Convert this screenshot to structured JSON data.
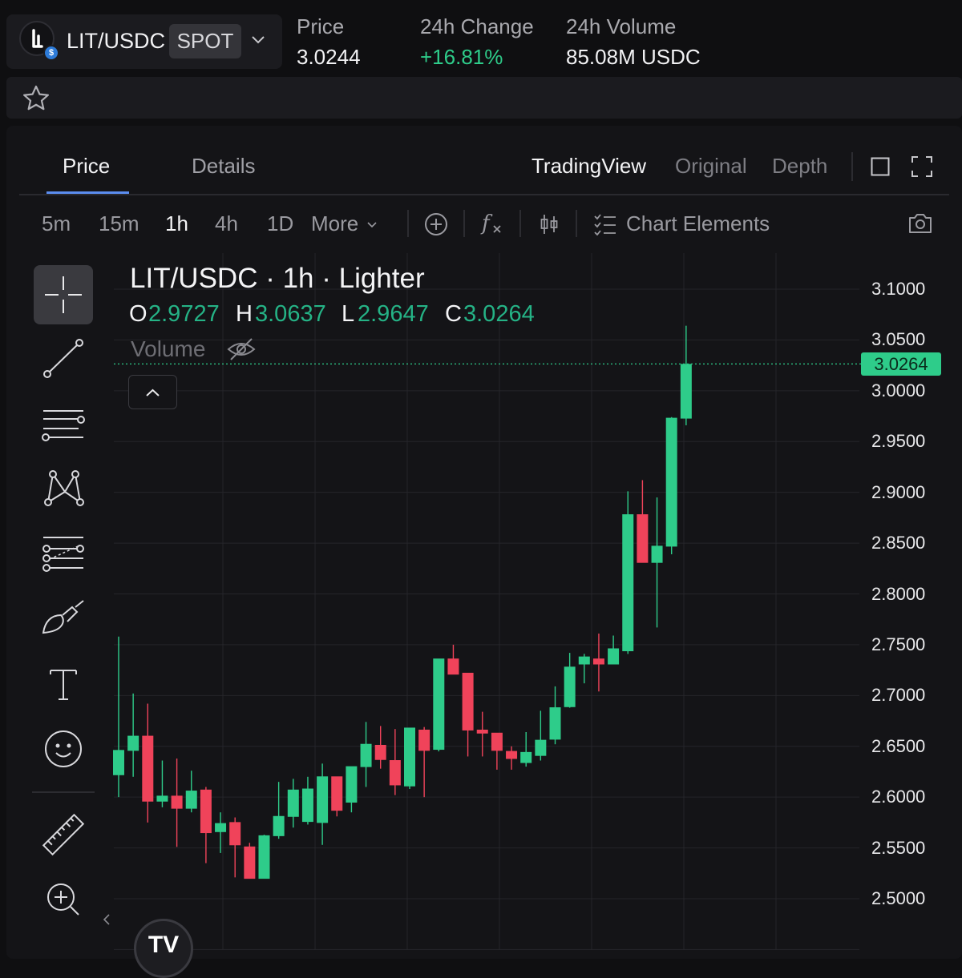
{
  "market": {
    "pair": "LIT/USDC",
    "type_badge": "SPOT",
    "stats": [
      {
        "label": "Price",
        "value": "3.0244",
        "color": "#f2f2f4"
      },
      {
        "label": "24h Change",
        "value": "+16.81%",
        "color": "#2ecc8a"
      },
      {
        "label": "24h Volume",
        "value": "85.08M USDC",
        "color": "#f2f2f4"
      }
    ]
  },
  "tabs": {
    "left": [
      {
        "label": "Price",
        "active": true
      },
      {
        "label": "Details",
        "active": false
      }
    ],
    "right": [
      {
        "label": "TradingView",
        "active": true
      },
      {
        "label": "Original",
        "active": false
      },
      {
        "label": "Depth",
        "active": false
      }
    ]
  },
  "toolbar": {
    "intervals": [
      {
        "label": "5m",
        "active": false
      },
      {
        "label": "15m",
        "active": false
      },
      {
        "label": "1h",
        "active": true
      },
      {
        "label": "4h",
        "active": false
      },
      {
        "label": "1D",
        "active": false
      }
    ],
    "more_label": "More",
    "chart_elements_label": "Chart Elements"
  },
  "drawing_tools": [
    {
      "name": "crosshair-icon",
      "active": true
    },
    {
      "name": "trend-line-icon",
      "active": false
    },
    {
      "name": "horizontal-lines-icon",
      "active": false
    },
    {
      "name": "pattern-icon",
      "active": false
    },
    {
      "name": "fib-icon",
      "active": false
    },
    {
      "name": "brush-icon",
      "active": false
    },
    {
      "name": "text-icon",
      "active": false
    },
    {
      "name": "emoji-icon",
      "active": false
    },
    {
      "name": "ruler-icon",
      "active": false
    },
    {
      "name": "zoom-in-icon",
      "active": false
    }
  ],
  "legend": {
    "title": "LIT/USDC · 1h · Lighter",
    "open_key": "O",
    "open": "2.9727",
    "high_key": "H",
    "high": "3.0637",
    "low_key": "L",
    "low": "2.9647",
    "close_key": "C",
    "close": "3.0264",
    "volume_label": "Volume"
  },
  "colors": {
    "up": "#2ecc8a",
    "down": "#f0435a",
    "accent": "#5b8def"
  },
  "chart_data": {
    "type": "candlestick",
    "interval": "1h",
    "last_price_label": "3.0264",
    "last_price": 3.0264,
    "y_ticks": [
      "3.1000",
      "3.0500",
      "3.0000",
      "2.9500",
      "2.9000",
      "2.8500",
      "2.8000",
      "2.7500",
      "2.7000",
      "2.6500",
      "2.6000",
      "2.5500",
      "2.5000"
    ],
    "ylim": [
      2.445,
      3.12
    ],
    "grid": true,
    "candles": [
      {
        "o": 2.622,
        "h": 2.758,
        "l": 2.6,
        "c": 2.646
      },
      {
        "o": 2.646,
        "h": 2.702,
        "l": 2.62,
        "c": 2.66
      },
      {
        "o": 2.66,
        "h": 2.692,
        "l": 2.575,
        "c": 2.596
      },
      {
        "o": 2.596,
        "h": 2.636,
        "l": 2.59,
        "c": 2.601
      },
      {
        "o": 2.601,
        "h": 2.638,
        "l": 2.551,
        "c": 2.589
      },
      {
        "o": 2.589,
        "h": 2.626,
        "l": 2.585,
        "c": 2.606
      },
      {
        "o": 2.607,
        "h": 2.61,
        "l": 2.535,
        "c": 2.565
      },
      {
        "o": 2.566,
        "h": 2.585,
        "l": 2.545,
        "c": 2.574
      },
      {
        "o": 2.575,
        "h": 2.58,
        "l": 2.521,
        "c": 2.553
      },
      {
        "o": 2.551,
        "h": 2.555,
        "l": 2.52,
        "c": 2.52
      },
      {
        "o": 2.52,
        "h": 2.563,
        "l": 2.52,
        "c": 2.562
      },
      {
        "o": 2.562,
        "h": 2.615,
        "l": 2.559,
        "c": 2.581
      },
      {
        "o": 2.581,
        "h": 2.618,
        "l": 2.57,
        "c": 2.607
      },
      {
        "o": 2.576,
        "h": 2.62,
        "l": 2.573,
        "c": 2.608
      },
      {
        "o": 2.575,
        "h": 2.633,
        "l": 2.553,
        "c": 2.62
      },
      {
        "o": 2.62,
        "h": 2.62,
        "l": 2.581,
        "c": 2.587
      },
      {
        "o": 2.595,
        "h": 2.63,
        "l": 2.585,
        "c": 2.63
      },
      {
        "o": 2.63,
        "h": 2.674,
        "l": 2.61,
        "c": 2.652
      },
      {
        "o": 2.651,
        "h": 2.67,
        "l": 2.628,
        "c": 2.637
      },
      {
        "o": 2.636,
        "h": 2.667,
        "l": 2.602,
        "c": 2.612
      },
      {
        "o": 2.611,
        "h": 2.668,
        "l": 2.608,
        "c": 2.668
      },
      {
        "o": 2.666,
        "h": 2.669,
        "l": 2.6,
        "c": 2.646
      },
      {
        "o": 2.647,
        "h": 2.735,
        "l": 2.645,
        "c": 2.736
      },
      {
        "o": 2.736,
        "h": 2.75,
        "l": 2.721,
        "c": 2.721
      },
      {
        "o": 2.722,
        "h": 2.721,
        "l": 2.64,
        "c": 2.666
      },
      {
        "o": 2.666,
        "h": 2.684,
        "l": 2.64,
        "c": 2.663
      },
      {
        "o": 2.663,
        "h": 2.661,
        "l": 2.627,
        "c": 2.646
      },
      {
        "o": 2.645,
        "h": 2.65,
        "l": 2.627,
        "c": 2.638
      },
      {
        "o": 2.634,
        "h": 2.664,
        "l": 2.63,
        "c": 2.644
      },
      {
        "o": 2.641,
        "h": 2.685,
        "l": 2.636,
        "c": 2.656
      },
      {
        "o": 2.657,
        "h": 2.709,
        "l": 2.652,
        "c": 2.688
      },
      {
        "o": 2.689,
        "h": 2.742,
        "l": 2.688,
        "c": 2.728
      },
      {
        "o": 2.731,
        "h": 2.741,
        "l": 2.712,
        "c": 2.738
      },
      {
        "o": 2.736,
        "h": 2.761,
        "l": 2.704,
        "c": 2.731
      },
      {
        "o": 2.731,
        "h": 2.759,
        "l": 2.741,
        "c": 2.746
      },
      {
        "o": 2.744,
        "h": 2.901,
        "l": 2.741,
        "c": 2.878
      },
      {
        "o": 2.878,
        "h": 2.912,
        "l": 2.832,
        "c": 2.831
      },
      {
        "o": 2.831,
        "h": 2.895,
        "l": 2.767,
        "c": 2.847
      },
      {
        "o": 2.847,
        "h": 2.974,
        "l": 2.839,
        "c": 2.973
      },
      {
        "o": 2.973,
        "h": 3.064,
        "l": 2.966,
        "c": 3.026
      }
    ]
  }
}
